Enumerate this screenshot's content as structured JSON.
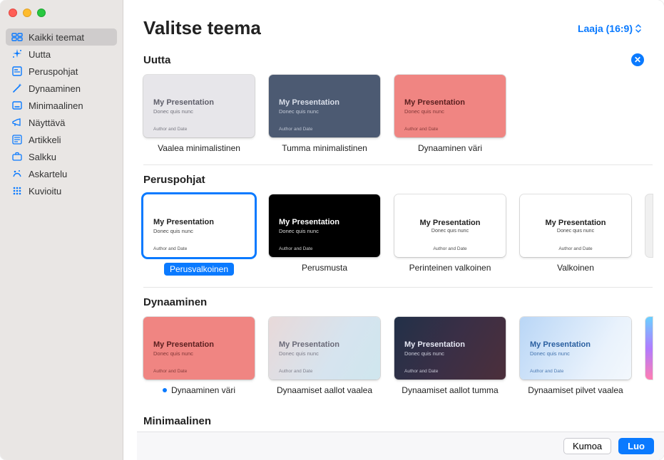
{
  "header": {
    "title": "Valitse teema",
    "aspect_label": "Laaja (16:9)"
  },
  "sidebar": {
    "items": [
      {
        "icon": "grid-icon",
        "label": "Kaikki teemat",
        "selected": true
      },
      {
        "icon": "sparkle-icon",
        "label": "Uutta"
      },
      {
        "icon": "page-icon",
        "label": "Peruspohjat"
      },
      {
        "icon": "wand-icon",
        "label": "Dynaaminen"
      },
      {
        "icon": "minimal-icon",
        "label": "Minimaalinen"
      },
      {
        "icon": "megaphone-icon",
        "label": "Näyttävä"
      },
      {
        "icon": "article-icon",
        "label": "Artikkeli"
      },
      {
        "icon": "briefcase-icon",
        "label": "Salkku"
      },
      {
        "icon": "craft-icon",
        "label": "Askartelu"
      },
      {
        "icon": "pattern-icon",
        "label": "Kuvioitu"
      }
    ]
  },
  "sample": {
    "title": "My Presentation",
    "subtitle": "Donec quis nunc",
    "footer": "Author and Date"
  },
  "sections": [
    {
      "title": "Uutta",
      "dismissable": true,
      "themes": [
        {
          "label": "Vaalea minimalistinen",
          "variant": "th-light-min"
        },
        {
          "label": "Tumma minimalistinen",
          "variant": "th-dark-min"
        },
        {
          "label": "Dynaaminen väri",
          "variant": "th-dyn-red"
        }
      ]
    },
    {
      "title": "Peruspohjat",
      "themes": [
        {
          "label": "Perusvalkoinen",
          "variant": "th-white",
          "selected": true,
          "pill": true
        },
        {
          "label": "Perusmusta",
          "variant": "th-black"
        },
        {
          "label": "Perinteinen valkoinen",
          "variant": "th-white th-center"
        },
        {
          "label": "Valkoinen",
          "variant": "th-white th-center"
        }
      ],
      "more": "sliver2"
    },
    {
      "title": "Dynaaminen",
      "themes": [
        {
          "label": "Dynaaminen väri",
          "variant": "th-dyn-red",
          "animated": true
        },
        {
          "label": "Dynaamiset aallot vaalea",
          "variant": "th-grad-lr"
        },
        {
          "label": "Dynaamiset aallot tumma",
          "variant": "th-grad-dk"
        },
        {
          "label": "Dynaamiset pilvet vaalea",
          "variant": "th-grad-bl"
        }
      ],
      "more": "sliver"
    },
    {
      "title": "Minimaalinen",
      "themes": []
    }
  ],
  "footer": {
    "cancel_label": "Kumoa",
    "create_label": "Luo"
  }
}
